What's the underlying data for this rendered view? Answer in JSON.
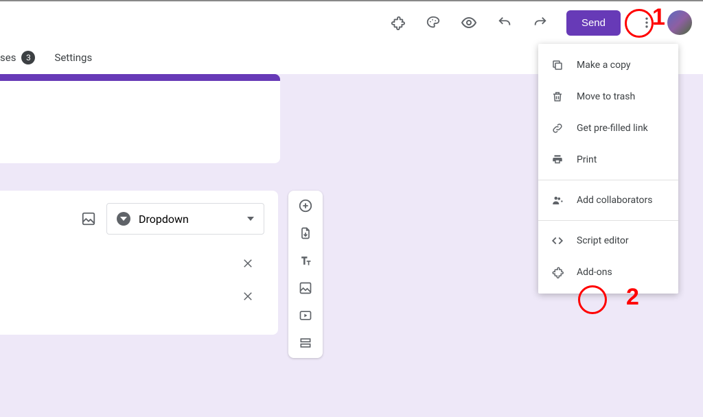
{
  "header": {
    "send_label": "Send"
  },
  "tabs": {
    "responses_label_fragment": "ses",
    "responses_count": "3",
    "settings_label": "Settings"
  },
  "question": {
    "type_label": "Dropdown"
  },
  "menu": {
    "items": [
      {
        "label": "Make a copy",
        "icon": "copy"
      },
      {
        "label": "Move to trash",
        "icon": "trash"
      },
      {
        "label": "Get pre-filled link",
        "icon": "link"
      },
      {
        "label": "Print",
        "icon": "print"
      },
      {
        "divider": true
      },
      {
        "label": "Add collaborators",
        "icon": "collab"
      },
      {
        "divider": true
      },
      {
        "label": "Script editor",
        "icon": "code"
      },
      {
        "label": "Add-ons",
        "icon": "puzzle"
      }
    ]
  },
  "annotations": {
    "one": "1",
    "two": "2"
  }
}
